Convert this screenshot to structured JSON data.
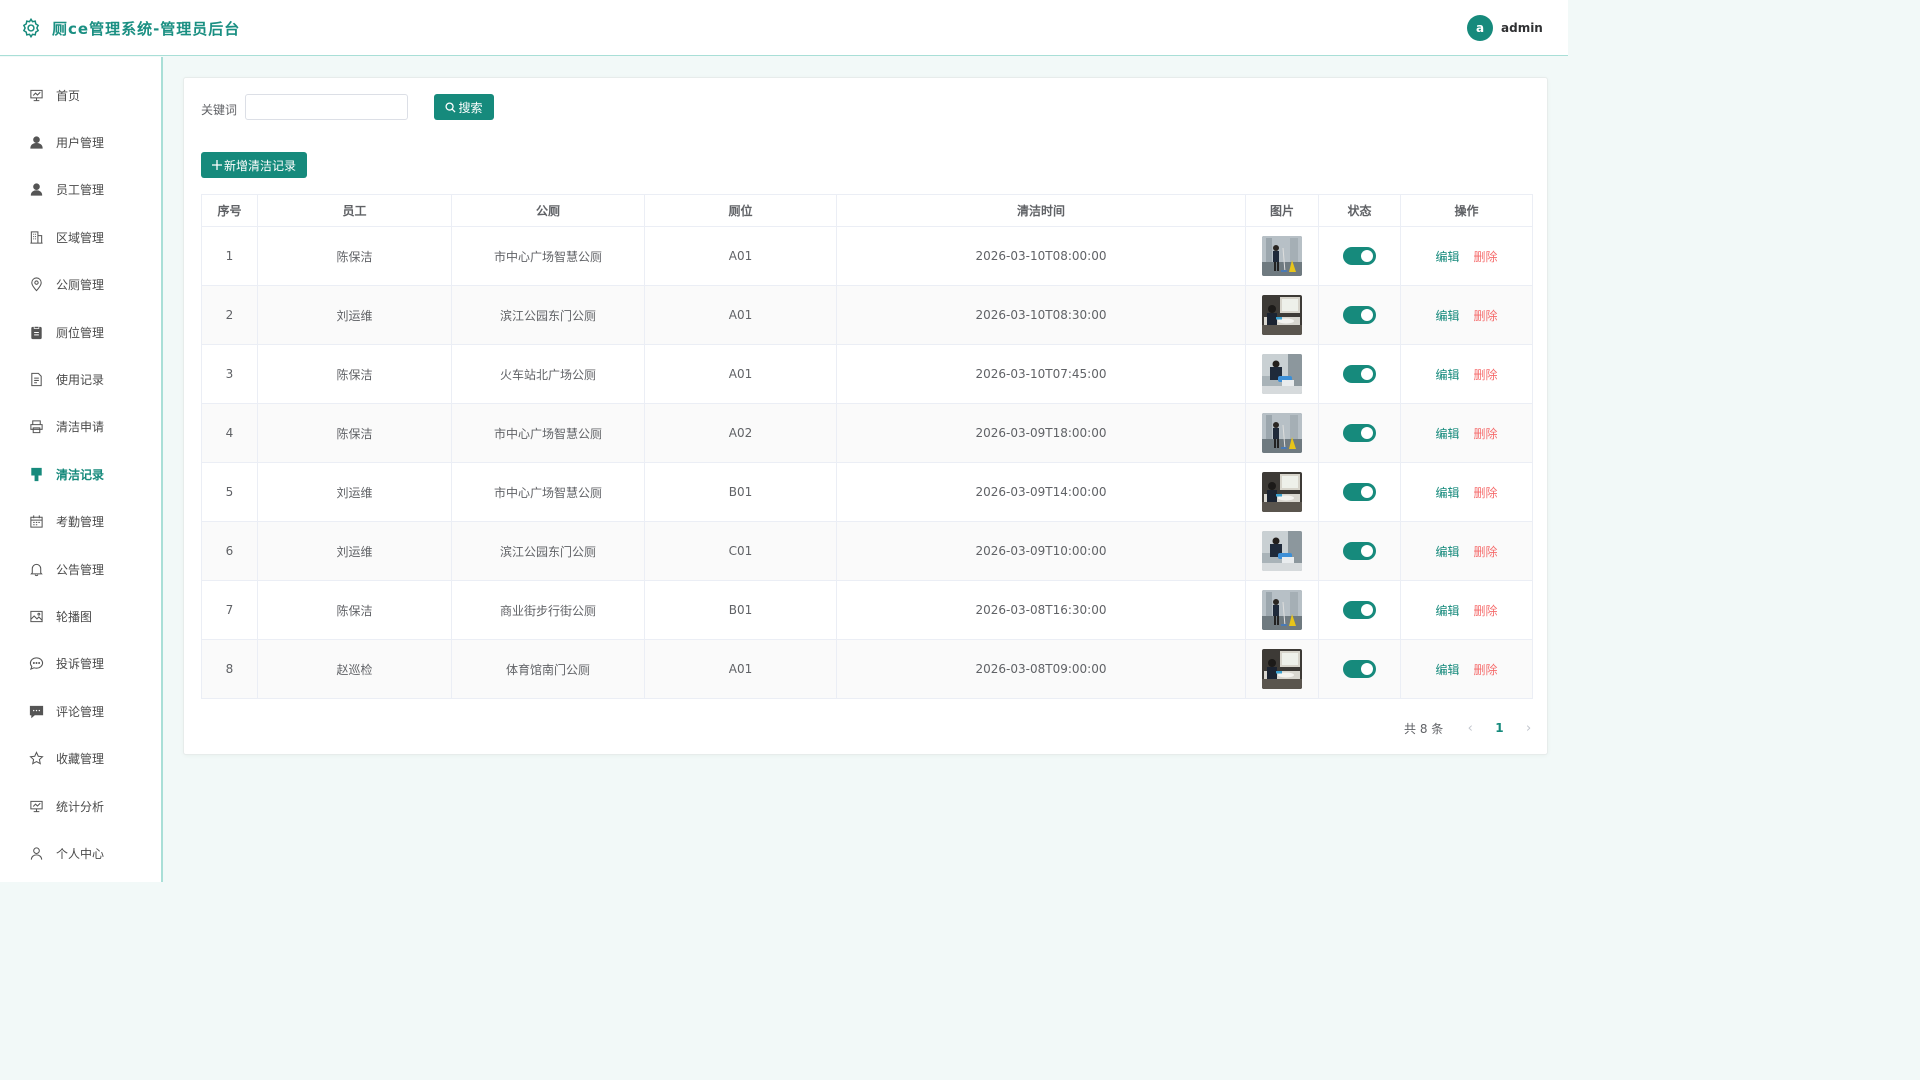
{
  "header": {
    "title": "厕ce管理系统-管理员后台",
    "avatar_letter": "a",
    "username": "admin"
  },
  "sidebar": {
    "items": [
      {
        "label": "首页",
        "icon": "dashboard-icon"
      },
      {
        "label": "用户管理",
        "icon": "user-solid-icon"
      },
      {
        "label": "员工管理",
        "icon": "user-icon"
      },
      {
        "label": "区域管理",
        "icon": "office-building-icon"
      },
      {
        "label": "公厕管理",
        "icon": "location-icon"
      },
      {
        "label": "厕位管理",
        "icon": "clipboard-icon"
      },
      {
        "label": "使用记录",
        "icon": "document-icon"
      },
      {
        "label": "清洁申请",
        "icon": "printer-icon"
      },
      {
        "label": "清洁记录",
        "icon": "brush-icon",
        "active": true
      },
      {
        "label": "考勤管理",
        "icon": "calendar-icon"
      },
      {
        "label": "公告管理",
        "icon": "bell-icon"
      },
      {
        "label": "轮播图",
        "icon": "picture-icon"
      },
      {
        "label": "投诉管理",
        "icon": "chat-dot-icon"
      },
      {
        "label": "评论管理",
        "icon": "chat-square-icon"
      },
      {
        "label": "收藏管理",
        "icon": "star-icon"
      },
      {
        "label": "统计分析",
        "icon": "data-board-icon"
      },
      {
        "label": "个人中心",
        "icon": "person-icon"
      }
    ]
  },
  "search": {
    "label": "关键词",
    "value": "",
    "placeholder": "",
    "button": "搜索"
  },
  "add_button": "新增清洁记录",
  "table": {
    "columns": [
      "序号",
      "员工",
      "公厕",
      "厕位",
      "清洁时间",
      "图片",
      "状态",
      "操作"
    ],
    "edit_label": "编辑",
    "delete_label": "删除",
    "rows": [
      {
        "no": "1",
        "staff": "陈保洁",
        "toilet": "市中心广场智慧公厕",
        "stall": "A01",
        "time": "2026-03-10T08:00:00",
        "photo": "mop",
        "status": true
      },
      {
        "no": "2",
        "staff": "刘运维",
        "toilet": "滨江公园东门公厕",
        "stall": "A01",
        "time": "2026-03-10T08:30:00",
        "photo": "sink",
        "status": true
      },
      {
        "no": "3",
        "staff": "陈保洁",
        "toilet": "火车站北广场公厕",
        "stall": "A01",
        "time": "2026-03-10T07:45:00",
        "photo": "gloves",
        "status": true
      },
      {
        "no": "4",
        "staff": "陈保洁",
        "toilet": "市中心广场智慧公厕",
        "stall": "A02",
        "time": "2026-03-09T18:00:00",
        "photo": "mop",
        "status": true
      },
      {
        "no": "5",
        "staff": "刘运维",
        "toilet": "市中心广场智慧公厕",
        "stall": "B01",
        "time": "2026-03-09T14:00:00",
        "photo": "sink",
        "status": true
      },
      {
        "no": "6",
        "staff": "刘运维",
        "toilet": "滨江公园东门公厕",
        "stall": "C01",
        "time": "2026-03-09T10:00:00",
        "photo": "gloves",
        "status": true
      },
      {
        "no": "7",
        "staff": "陈保洁",
        "toilet": "商业街步行街公厕",
        "stall": "B01",
        "time": "2026-03-08T16:30:00",
        "photo": "mop",
        "status": true
      },
      {
        "no": "8",
        "staff": "赵巡检",
        "toilet": "体育馆南门公厕",
        "stall": "A01",
        "time": "2026-03-08T09:00:00",
        "photo": "sink",
        "status": true
      }
    ]
  },
  "pagination": {
    "total_text": "共 8 条",
    "current_page": "1"
  },
  "colors": {
    "primary": "#168a7c",
    "danger": "#f56c6c",
    "background": "#f2f9f8"
  }
}
